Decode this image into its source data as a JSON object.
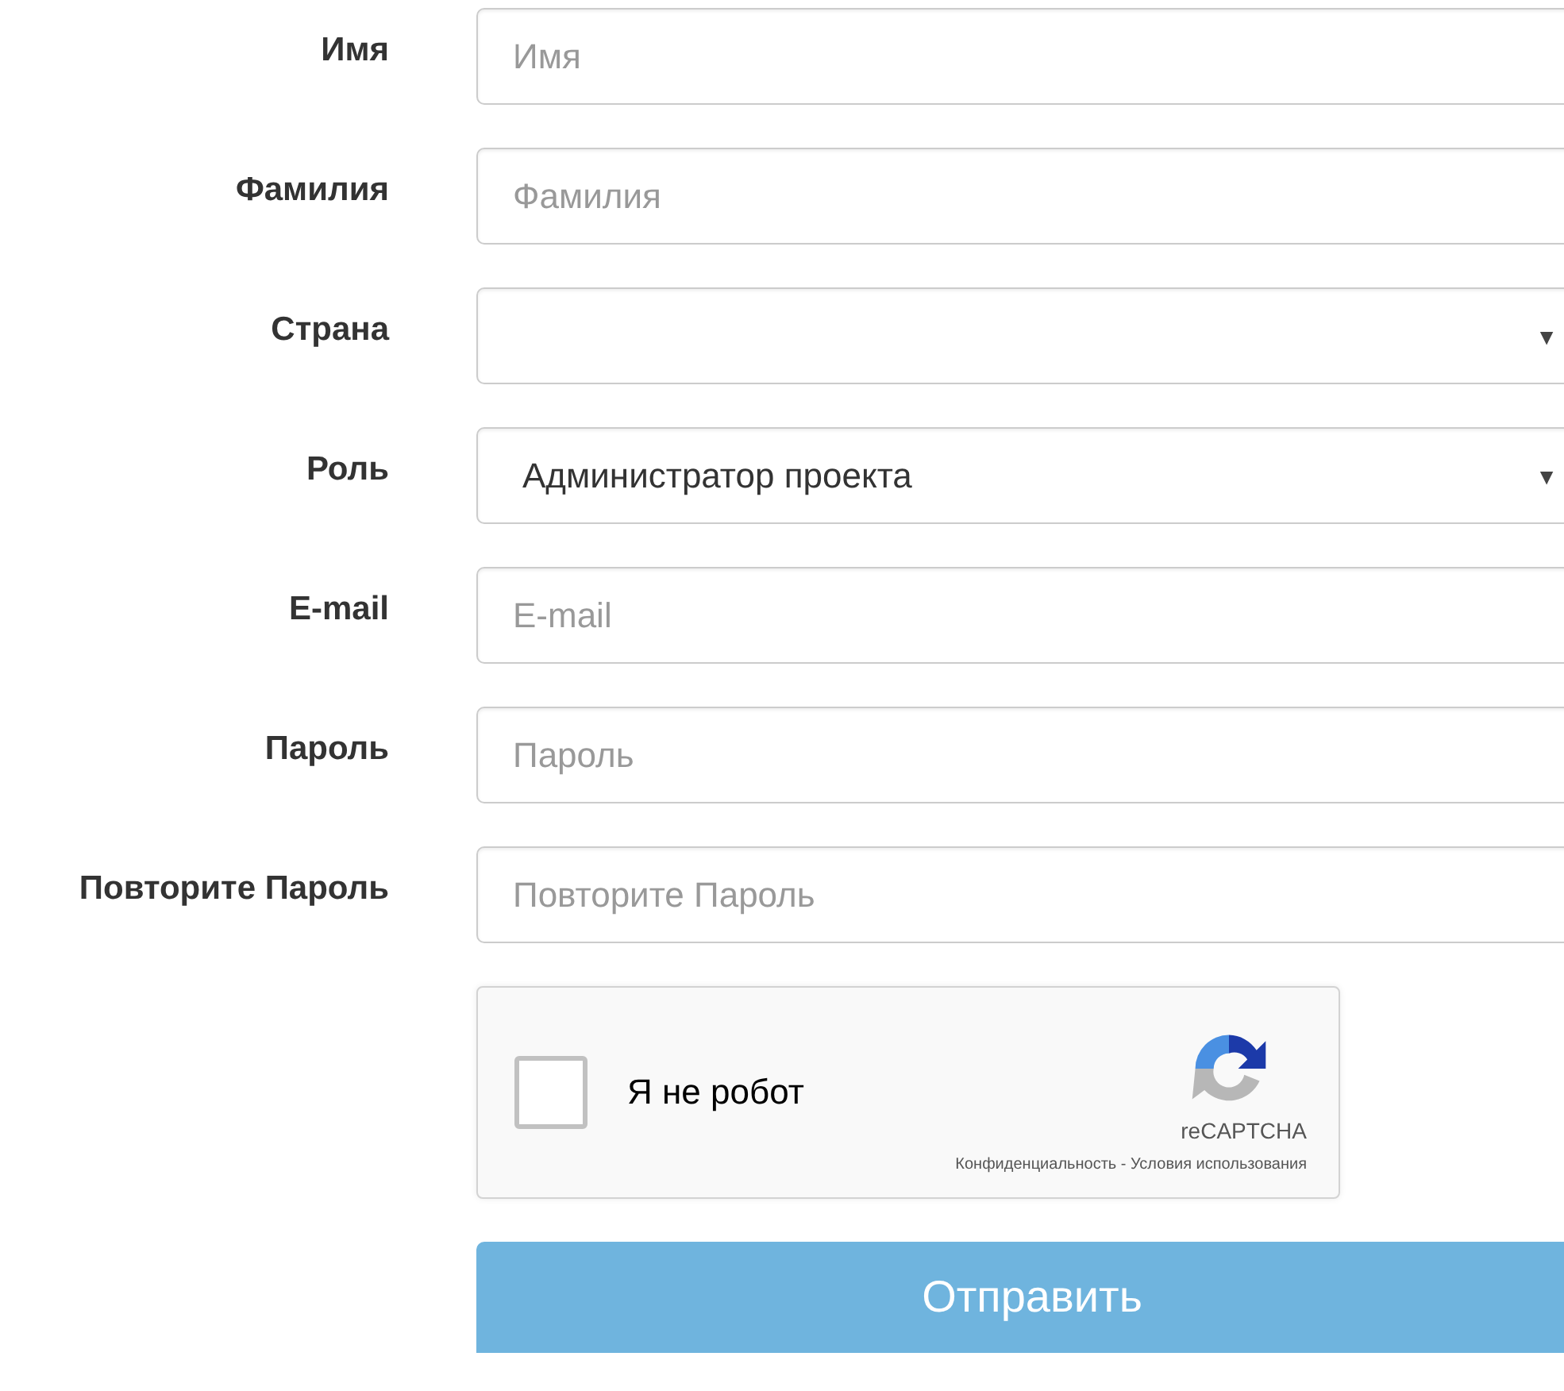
{
  "fields": [
    {
      "kind": "text",
      "label": "Имя",
      "placeholder": "Имя"
    },
    {
      "kind": "text",
      "label": "Фамилия",
      "placeholder": "Фамилия"
    },
    {
      "kind": "select",
      "label": "Страна",
      "arrow": "▼"
    },
    {
      "kind": "select",
      "label": "Роль",
      "value": "Администратор проекта",
      "arrow": "▼"
    },
    {
      "kind": "text",
      "label": "E-mail",
      "placeholder": "E-mail"
    },
    {
      "kind": "text",
      "label": "Пароль",
      "placeholder": "Пароль"
    },
    {
      "kind": "text",
      "label": "Повторите Пароль",
      "placeholder": "Повторите Пароль"
    }
  ],
  "captcha": {
    "label": "Я не робот",
    "checked": false,
    "brand": "reCAPTCHA",
    "privacy": "Конфиденциальность",
    "separator": " - ",
    "terms": "Условия использования"
  },
  "submit": {
    "label": "Отправить"
  }
}
